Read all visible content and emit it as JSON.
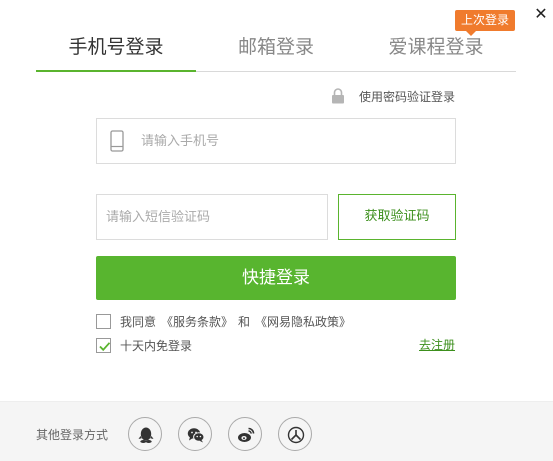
{
  "dialog": {
    "close_label": "✕"
  },
  "tabs": [
    {
      "label": "手机号登录",
      "active": true
    },
    {
      "label": "邮箱登录",
      "active": false
    },
    {
      "label": "爱课程登录",
      "active": false
    }
  ],
  "last_login_badge": "上次登录",
  "password_login": {
    "label": "使用密码验证登录",
    "icon": "lock-icon"
  },
  "phone": {
    "placeholder": "请输入手机号",
    "value": "",
    "icon": "phone-icon"
  },
  "sms": {
    "placeholder": "请输入短信验证码",
    "value": "",
    "button_label": "获取验证码"
  },
  "login_button": "快捷登录",
  "agreement": {
    "checked": false,
    "prefix": "我同意",
    "terms": "《服务条款》",
    "conjunction": "和",
    "privacy": "《网易隐私政策》"
  },
  "remember": {
    "checked": true,
    "label": "十天内免登录"
  },
  "register_link": "去注册",
  "footer": {
    "label": "其他登录方式",
    "providers": [
      "qq-icon",
      "wechat-icon",
      "weibo-icon",
      "yixin-icon"
    ]
  },
  "colors": {
    "accent": "#58b52f",
    "accent_text": "#3c8f1c",
    "badge": "#f07b2d",
    "footer_bg": "#f5f5f5"
  }
}
